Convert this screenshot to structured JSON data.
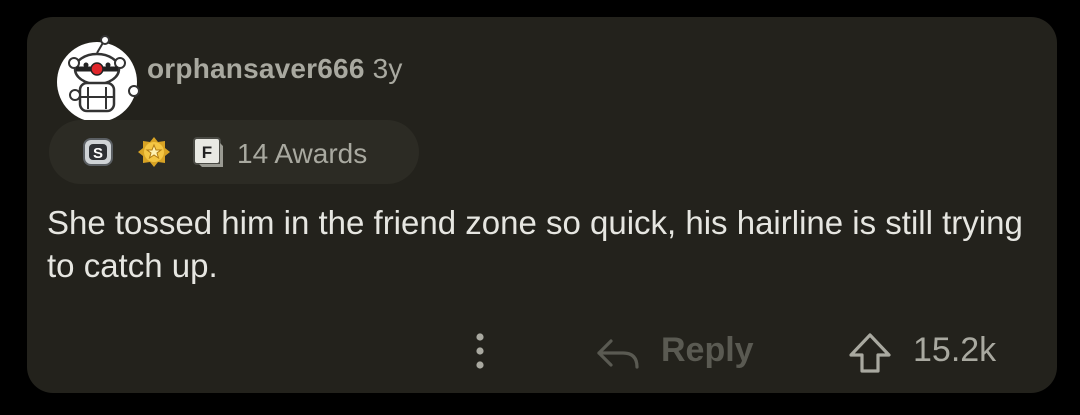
{
  "comment": {
    "username": "orphansaver666",
    "age": "3y",
    "awards": {
      "icons": [
        "silver-award-icon",
        "gold-star-award-icon",
        "f-award-icon"
      ],
      "icon_letters": [
        "S",
        "F"
      ],
      "label": "14 Awards"
    },
    "body": "She tossed him in the friend zone so quick, his hairline is still trying to catch up.",
    "actions": {
      "reply_label": "Reply",
      "vote_count": "15.2k"
    }
  },
  "colors": {
    "background": "#000000",
    "card": "#23221c",
    "text_primary": "#e6e6e1",
    "text_secondary": "#a9a9a0",
    "text_disabled": "#5a5a52"
  }
}
